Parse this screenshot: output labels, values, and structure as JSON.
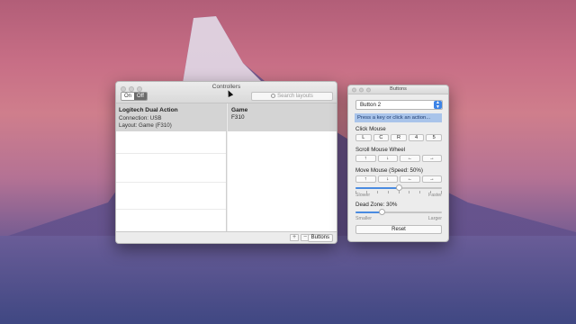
{
  "controllers_window": {
    "title": "Controllers",
    "toggle_on": "On",
    "toggle_off": "Off",
    "search_placeholder": "Search layouts",
    "selected_device": {
      "name": "Logitech Dual Action",
      "connection": "Connection: USB",
      "layout": "Layout: Game (F310)"
    },
    "layout_column": {
      "header": "Game",
      "value": "F310"
    },
    "add_label": "+",
    "remove_label": "−",
    "buttons_label": "Buttons"
  },
  "buttons_window": {
    "title": "Buttons",
    "selected_button": "Button 2",
    "hint": "Press a key or click an action...",
    "click_mouse": {
      "label": "Click Mouse",
      "options": [
        "L",
        "C",
        "R",
        "4",
        "5"
      ]
    },
    "scroll_wheel": {
      "label": "Scroll Mouse Wheel",
      "options": [
        "↑",
        "↓",
        "←",
        "→"
      ]
    },
    "move_mouse": {
      "label": "Move Mouse (Speed: 50%)",
      "options": [
        "↑",
        "↓",
        "←",
        "→"
      ],
      "speed": 0.5,
      "min_label": "Slower",
      "max_label": "Faster"
    },
    "dead_zone": {
      "label": "Dead Zone: 30%",
      "value": 0.3,
      "min_label": "Smaller",
      "max_label": "Larger"
    },
    "reset_label": "Reset"
  },
  "colors": {
    "accent": "#3d84e6",
    "selection": "#d4d4d4",
    "hint_bg": "#a9c4ea"
  }
}
